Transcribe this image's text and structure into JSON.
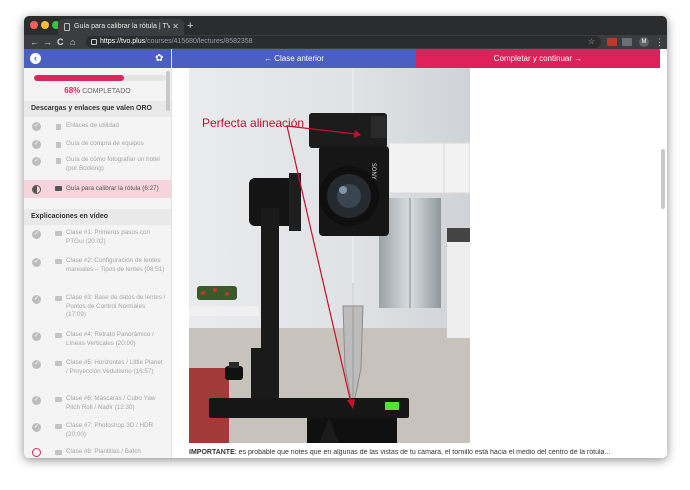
{
  "browser": {
    "tab_title": "Guía para calibrar la rótula | TVO",
    "tab_close": "✕",
    "new_tab": "+",
    "url_host": "https://tvo.plus",
    "url_path": "/courses/415680/lectures/8582358",
    "avatar_letter": "M",
    "nav_back": "←",
    "nav_forward": "→",
    "nav_reload": "C",
    "nav_home": "⌂",
    "bookmark_star": "☆",
    "menu": "⋮"
  },
  "sidebar": {
    "back_glyph": "‹",
    "settings_glyph": "✿",
    "progress_fraction": 0.68,
    "progress_pct": "68%",
    "progress_label": "COMPLETADO",
    "section_downloads": "Descargas y enlaces que valen ORO",
    "section_videos": "Explicaciones en vídeo",
    "downloads": [
      {
        "label": "Enlaces de utilidad",
        "type": "doc",
        "state": "done"
      },
      {
        "label": "Guía de compra de equipos",
        "type": "doc",
        "state": "done"
      },
      {
        "label": "Guía de cómo fotografiar un hotel (por Booking)",
        "type": "doc",
        "state": "done"
      },
      {
        "label": "Guía para calibrar la rótula (6:27)",
        "type": "video",
        "state": "active"
      }
    ],
    "videos": [
      {
        "label": "Clase #1: Primeros pasos con PTGui (20:02)",
        "type": "video",
        "state": "done"
      },
      {
        "label": "Clase #2: Configuración de lentes manuales – Tipos de lentes (08:51)",
        "type": "video",
        "state": "done"
      },
      {
        "label": "Clase #3: Base de datos de lentes / Puntos de Control Normales (17:09)",
        "type": "video",
        "state": "done"
      },
      {
        "label": "Clase #4: Retrato Panorámico / Líneas Verticales (20:00)",
        "type": "video",
        "state": "done"
      },
      {
        "label": "Clase #5: Horizontes / Little Planet / Proyección Vedutismo (16:57)",
        "type": "video",
        "state": "done"
      },
      {
        "label": "Clase #6: Máscaras / Cubo Yaw Pitch Roll / Nadir (12:30)",
        "type": "video",
        "state": "done"
      },
      {
        "label": "Clase #7: Photoshop 3D / HDR (20:00)",
        "type": "video",
        "state": "done"
      },
      {
        "label": "Clase #8: Plantillas / Batch",
        "type": "video",
        "state": "pending"
      }
    ]
  },
  "main": {
    "prev_label": "← Clase anterior",
    "next_label": "Completar y continuar →",
    "photo_annotation": "Perfecta alineación",
    "camera_brand": "SONY",
    "body_bold": "IMPORTANTE",
    "body_rest": ": es probable que notes que en algunas de las vistas de tu cámara, el tornillo está hacia el medio del centro de la rótula..."
  },
  "colors": {
    "accent_blue": "#4a5fc1",
    "accent_pink": "#e0205a",
    "annotation_red": "#c8102e"
  }
}
